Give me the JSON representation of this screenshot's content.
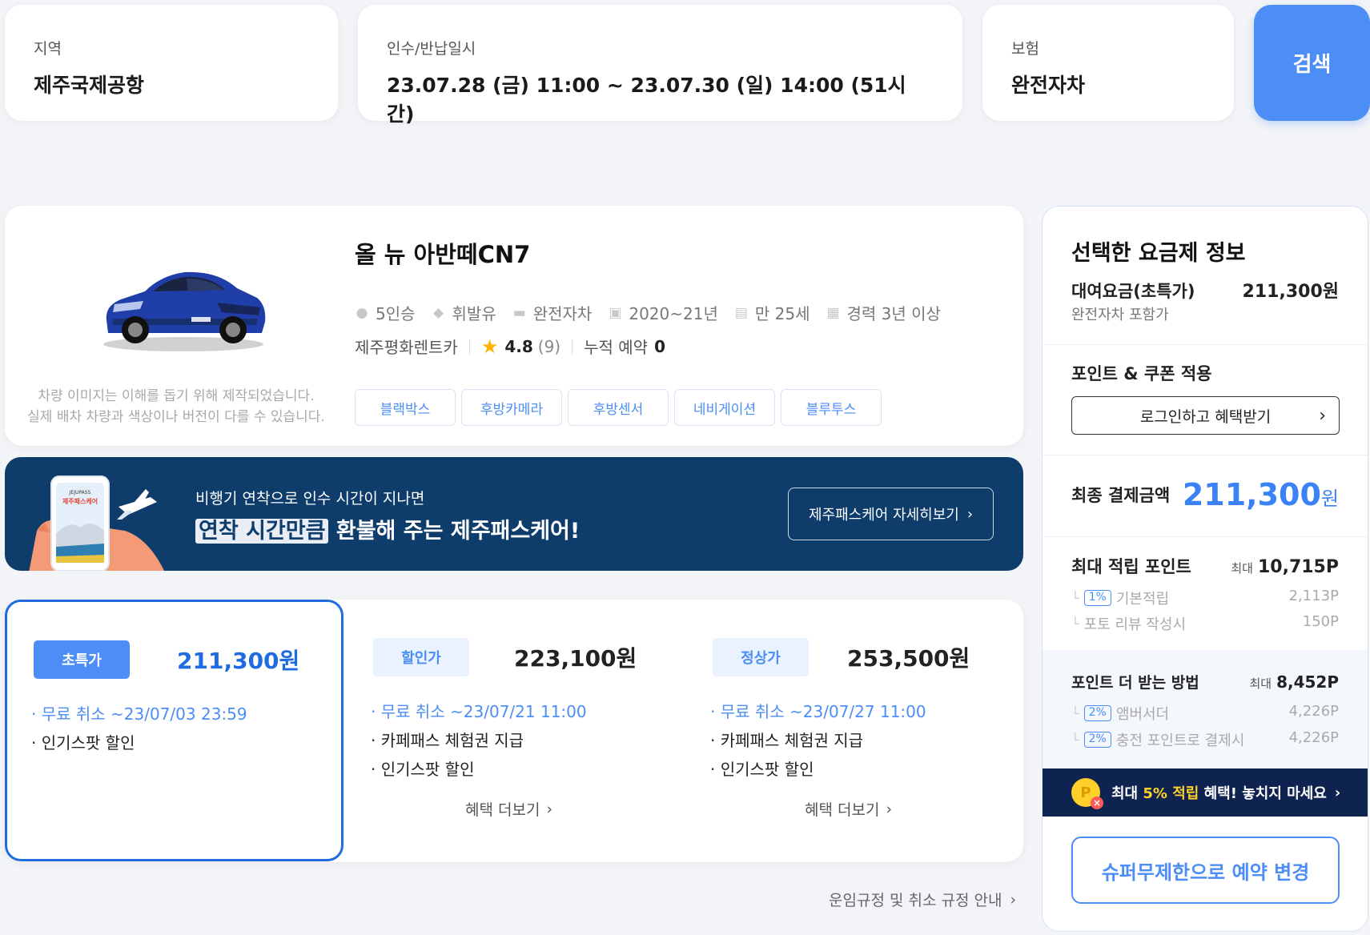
{
  "search": {
    "region_label": "지역",
    "region_value": "제주국제공항",
    "dates_label": "인수/반납일시",
    "dates_value": "23.07.28 (금) 11:00 ~ 23.07.30 (일) 14:00 (51시간)",
    "insurance_label": "보험",
    "insurance_value": "완전자차",
    "search_button": "검색"
  },
  "car": {
    "name": "올 뉴 아반떼CN7",
    "disclaimer_line1": "차량 이미지는 이해를 돕기 위해 제작되었습니다.",
    "disclaimer_line2": "실제 배차 차량과 색상이나 버전이 다를 수 있습니다.",
    "specs": [
      {
        "icon": "person-icon",
        "text": "5인승"
      },
      {
        "icon": "fuel-drop-icon",
        "text": "휘발유"
      },
      {
        "icon": "insurance-icon",
        "text": "완전자차"
      },
      {
        "icon": "calendar-icon",
        "text": "2020~21년"
      },
      {
        "icon": "age-icon",
        "text": "만 25세"
      },
      {
        "icon": "license-icon",
        "text": "경력 3년 이상"
      }
    ],
    "company": "제주평화렌트카",
    "rating": "4.8",
    "rating_count": "(9)",
    "bookings_label": "누적 예약",
    "bookings_value": "0",
    "options": [
      "블랙박스",
      "후방카메라",
      "후방센서",
      "네비게이션",
      "블루투스"
    ],
    "car_color": "#1f3ea8"
  },
  "banner": {
    "app_text_small": "JEJUPASS",
    "app_text": "제주패스케어",
    "sub": "비행기 연착으로 인수 시간이 지나면",
    "highlight": "연착 시간만큼",
    "main_rest": " 환불해 주는 제주패스케어!",
    "button": "제주패스케어 자세히보기",
    "bg_color": "#0e3d6b"
  },
  "plans": [
    {
      "badge": "초특가",
      "price": "211,300원",
      "benefits": [
        "무료 취소 ~23/07/03 23:59",
        "인기스팟 할인"
      ],
      "more": ""
    },
    {
      "badge": "할인가",
      "price": "223,100원",
      "benefits": [
        "무료 취소 ~23/07/21 11:00",
        "카페패스 체험권 지급",
        "인기스팟 할인"
      ],
      "more": "혜택 더보기"
    },
    {
      "badge": "정상가",
      "price": "253,500원",
      "benefits": [
        "무료 취소 ~23/07/27 11:00",
        "카페패스 체험권 지급",
        "인기스팟 할인"
      ],
      "more": "혜택 더보기"
    }
  ],
  "fare_rules": "운임규정 및 취소 규정 안내",
  "panel": {
    "title": "선택한 요금제 정보",
    "rental_label": "대여요금(초특가)",
    "rental_price": "211,300원",
    "rental_sub": "완전자차 포함가",
    "coupon_title": "포인트 & 쿠폰 적용",
    "login_button": "로그인하고 혜택받기",
    "final_label": "최종 결제금액",
    "final_price": "211,300",
    "final_unit": "원",
    "max_points_label": "최대 적립 포인트",
    "max_small": "최대",
    "max_points_value": "10,715P",
    "basic_pct": "1%",
    "basic_label": "기본적립",
    "basic_value": "2,113P",
    "review_label": "포토 리뷰 작성시",
    "review_value": "150P",
    "more_label": "포인트 더 받는 방법",
    "more_value": "8,452P",
    "amb_pct": "2%",
    "amb_label": "앰버서더",
    "amb_value": "4,226P",
    "charge_pct": "2%",
    "charge_label": "충전 포인트로 결제시",
    "charge_value": "4,226P",
    "promo_coin": "P",
    "promo_pre": "최대 ",
    "promo_hl": "5% 적립",
    "promo_post": " 혜택! 놓치지 마세요",
    "change_button": "슈퍼무제한으로 예약 변경"
  }
}
